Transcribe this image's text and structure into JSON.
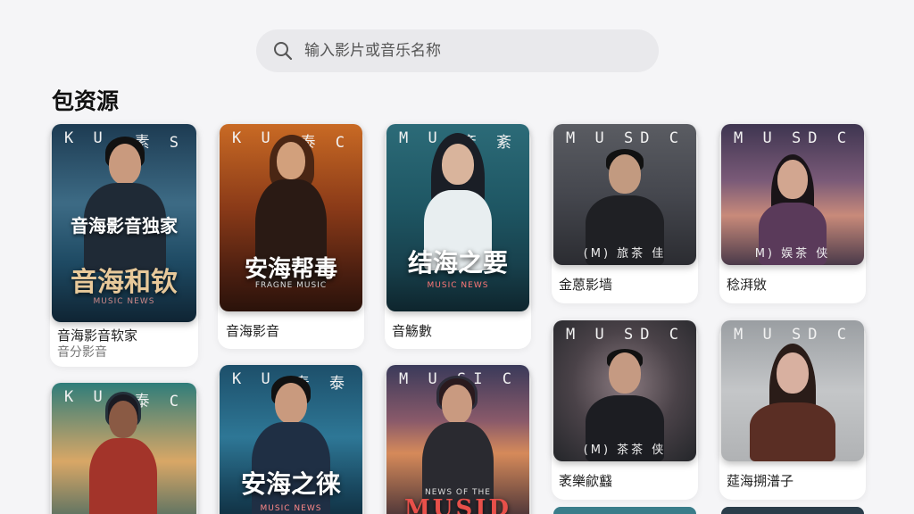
{
  "search": {
    "placeholder": "输入影片或音乐名称"
  },
  "section": {
    "title": "包资源"
  },
  "cards": [
    {
      "brand_left": "K U",
      "brand_right": "素 S",
      "banner": "音海影音独家",
      "big_title": "音海和钦",
      "small_text": "MUSIC NEWS",
      "title": "音海影音软家",
      "subtitle": "音分影音"
    },
    {
      "brand_left": "K U",
      "brand_right": "泰 C",
      "big_title": "安海帮毒",
      "small_text": "FRAGNE MUSIC",
      "title": "音海影音"
    },
    {
      "brand_left": "M U",
      "brand_right": "紊 紊",
      "big_title": "结海之要",
      "small_text": "MUSIC NEWS",
      "title": "音觞數"
    },
    {
      "brand_left": "M U S",
      "brand_right": "D C",
      "caption": "(M) 旅茶 佳",
      "title": "金蒽影墙"
    },
    {
      "brand_left": "M U S",
      "brand_right": "D C",
      "caption": "M) 娱茶 侠",
      "title": "稔湃敓"
    },
    {
      "brand_left": "K U",
      "brand_right": "泰 C"
    },
    {
      "brand_left": "K U",
      "brand_right": "泰 泰",
      "big_title": "安海之徕",
      "small_text": "MUSIC NEWS"
    },
    {
      "brand_left": "M U S",
      "brand_right": "I C",
      "big_title": "MUSID",
      "small_text": "NEWS OF THE"
    },
    {
      "brand_left": "M U S",
      "brand_right": "D C",
      "caption": "(M) 茶茶 侠",
      "title": "袤樂歈蠽"
    },
    {
      "brand_left": "M U S",
      "brand_right": "D C",
      "title": "莚海搠潽子"
    }
  ]
}
